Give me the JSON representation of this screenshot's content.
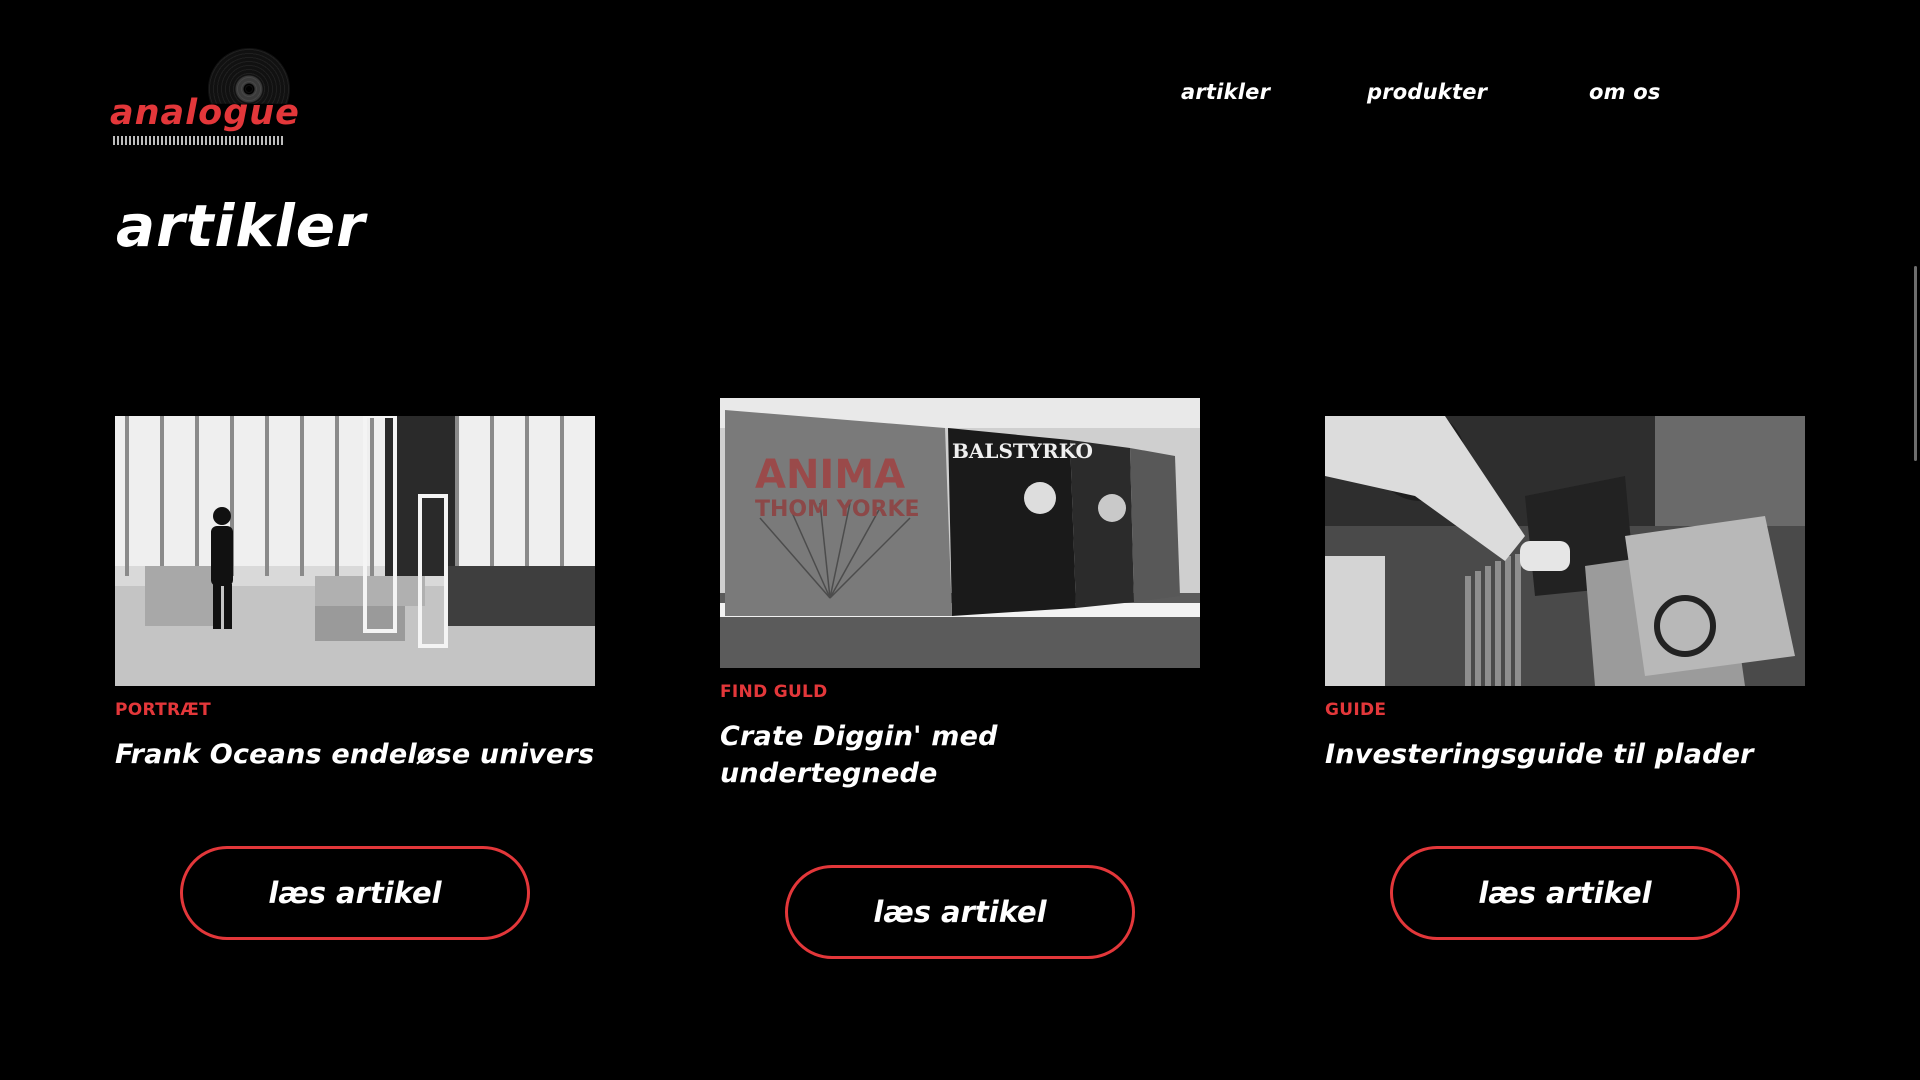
{
  "header": {
    "logo_text": "analogue",
    "nav": [
      {
        "label": "artikler"
      },
      {
        "label": "produkter"
      },
      {
        "label": "om os"
      }
    ]
  },
  "page": {
    "title": "artikler"
  },
  "articles": [
    {
      "category": "PORTRÆT",
      "title": "Frank Oceans endeløse univers",
      "button_label": "læs artikel"
    },
    {
      "category": "FIND GULD",
      "title": "Crate Diggin' med undertegnede",
      "button_label": "læs artikel",
      "image_text": [
        "ANIMA",
        "THOM YORKE",
        "BALSTYRKO"
      ]
    },
    {
      "category": "GUIDE",
      "title": "Investeringsguide til plader",
      "button_label": "læs artikel"
    }
  ],
  "colors": {
    "background": "#000000",
    "accent": "#e3373a",
    "text": "#ffffff"
  }
}
